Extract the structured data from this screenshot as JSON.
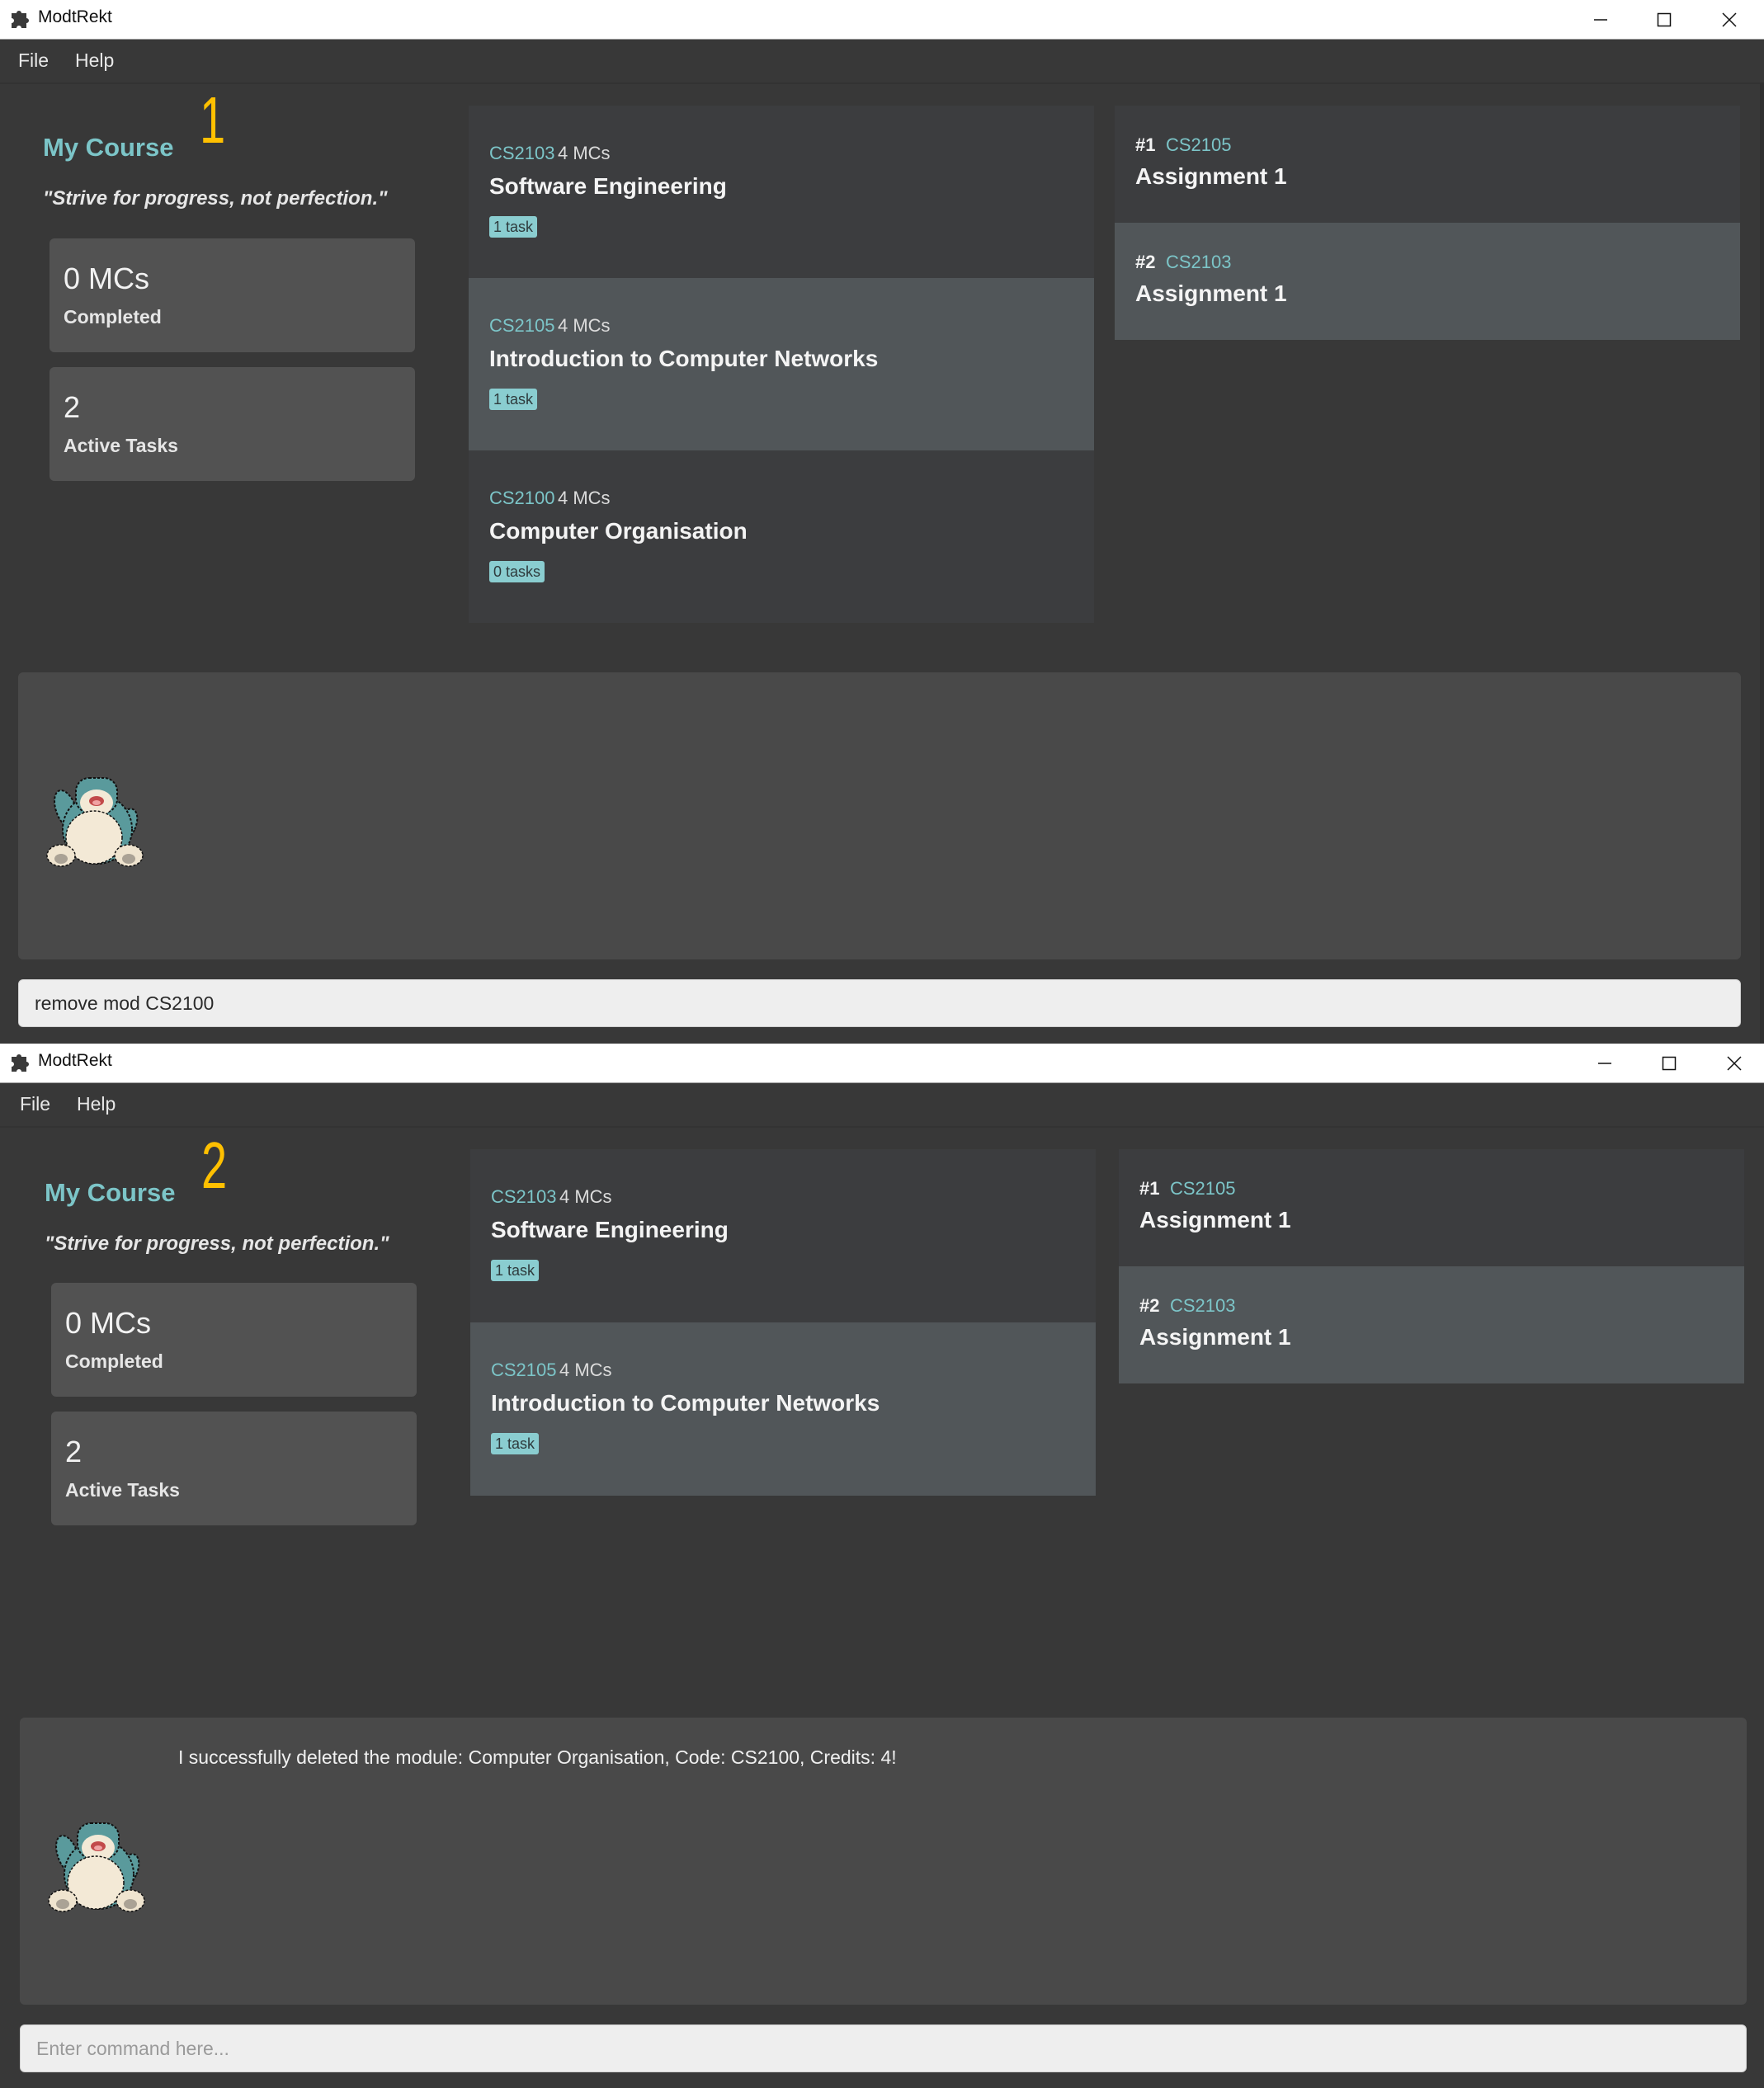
{
  "windows": [
    {
      "step_label": "1",
      "app_title": "ModtRekt",
      "menu": [
        "File",
        "Help"
      ],
      "course": {
        "title": "My Course",
        "quote": "\"Strive for progress, not perfection.\"",
        "stats": [
          {
            "value": "0 MCs",
            "label": "Completed"
          },
          {
            "value": "2",
            "label": "Active Tasks"
          }
        ]
      },
      "modules": [
        {
          "code": "CS2103",
          "mcs": "4 MCs",
          "name": "Software Engineering",
          "tasks": "1 task"
        },
        {
          "code": "CS2105",
          "mcs": "4 MCs",
          "name": "Introduction to Computer Networks",
          "tasks": "1 task"
        },
        {
          "code": "CS2100",
          "mcs": "4 MCs",
          "name": "Computer Organisation",
          "tasks": "0 tasks"
        }
      ],
      "tasks": [
        {
          "index": "#1",
          "code": "CS2105",
          "name": "Assignment 1"
        },
        {
          "index": "#2",
          "code": "CS2103",
          "name": "Assignment 1"
        }
      ],
      "result_message": "",
      "command": {
        "value": "remove mod CS2100",
        "placeholder": "Enter command here..."
      }
    },
    {
      "step_label": "2",
      "app_title": "ModtRekt",
      "menu": [
        "File",
        "Help"
      ],
      "course": {
        "title": "My Course",
        "quote": "\"Strive for progress, not perfection.\"",
        "stats": [
          {
            "value": "0 MCs",
            "label": "Completed"
          },
          {
            "value": "2",
            "label": "Active Tasks"
          }
        ]
      },
      "modules": [
        {
          "code": "CS2103",
          "mcs": "4 MCs",
          "name": "Software Engineering",
          "tasks": "1 task"
        },
        {
          "code": "CS2105",
          "mcs": "4 MCs",
          "name": "Introduction to Computer Networks",
          "tasks": "1 task"
        }
      ],
      "tasks": [
        {
          "index": "#1",
          "code": "CS2105",
          "name": "Assignment 1"
        },
        {
          "index": "#2",
          "code": "CS2103",
          "name": "Assignment 1"
        }
      ],
      "result_message": "I successfully deleted the module: Computer Organisation, Code: CS2100, Credits: 4!",
      "command": {
        "value": "",
        "placeholder": "Enter command here..."
      }
    }
  ],
  "icons": {
    "app": "puzzle-piece-icon",
    "minimize": "minimize-icon",
    "maximize": "maximize-icon",
    "close": "close-icon",
    "mascot": "snorlax-mascot"
  },
  "colors": {
    "background": "#383838",
    "accent_teal": "#7cc5c8",
    "badge": "#8acdd0",
    "step_label": "#ffc000",
    "row_alt": "#515659",
    "row": "#3c3d3f",
    "card": "#525252",
    "result_bg": "#494949",
    "command_bg": "#eeeeee"
  }
}
